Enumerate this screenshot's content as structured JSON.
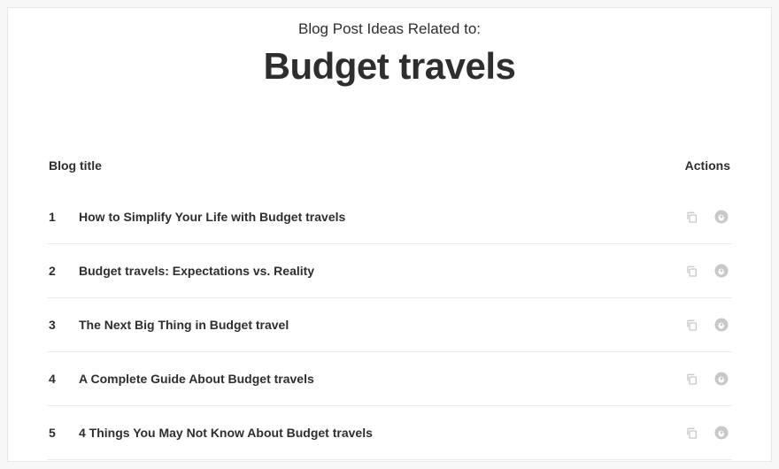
{
  "header": {
    "label": "Blog Post Ideas Related to:",
    "topic": "Budget travels"
  },
  "table": {
    "title_label": "Blog title",
    "actions_label": "Actions"
  },
  "rows": [
    {
      "index": "1",
      "title": "How to Simplify Your Life with Budget travels"
    },
    {
      "index": "2",
      "title": "Budget travels: Expectations vs. Reality"
    },
    {
      "index": "3",
      "title": "The Next Big Thing in Budget travel"
    },
    {
      "index": "4",
      "title": "A Complete Guide About Budget travels"
    },
    {
      "index": "5",
      "title": "4 Things You May Not Know About Budget travels"
    }
  ]
}
